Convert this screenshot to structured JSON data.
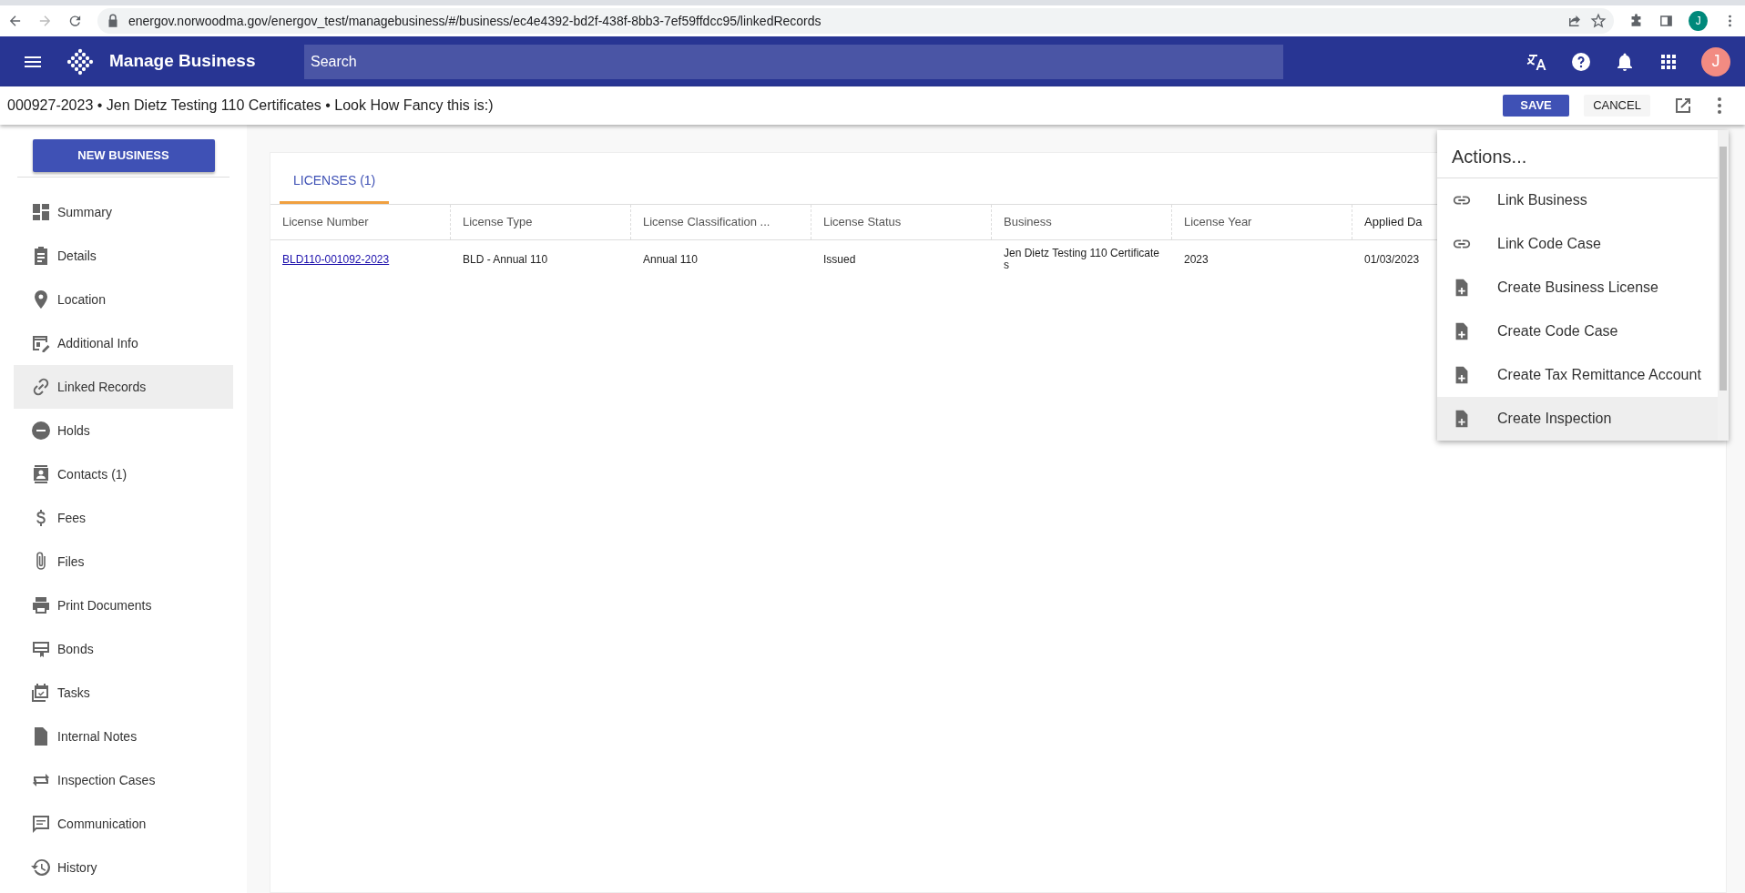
{
  "browser": {
    "url": "energov.norwoodma.gov/energov_test/managebusiness/#/business/ec4e4392-bd2f-438f-8bb3-7ef59ffdcc95/linkedRecords",
    "profile_initial": "J"
  },
  "app_bar": {
    "title": "Manage Business",
    "search": {
      "placeholder": "Search"
    },
    "user_initial": "J"
  },
  "record_bar": {
    "title": "000927-2023 • Jen Dietz Testing 110 Certificates • Look How Fancy this is:)",
    "buttons": [
      {
        "label": "SAVE",
        "kind": "primary"
      },
      {
        "label": "CANCEL",
        "kind": "plain"
      }
    ]
  },
  "sidebar": {
    "new_button": "NEW BUSINESS",
    "items": [
      {
        "label": "Summary",
        "selected": false
      },
      {
        "label": "Details",
        "selected": false
      },
      {
        "label": "Location",
        "selected": false
      },
      {
        "label": "Additional Info",
        "selected": false
      },
      {
        "label": "Linked Records",
        "selected": true
      },
      {
        "label": "Holds",
        "selected": false
      },
      {
        "label": "Contacts (1)",
        "selected": false
      },
      {
        "label": "Fees",
        "selected": false
      },
      {
        "label": "Files",
        "selected": false
      },
      {
        "label": "Print Documents",
        "selected": false
      },
      {
        "label": "Bonds",
        "selected": false
      },
      {
        "label": "Tasks",
        "selected": false
      },
      {
        "label": "Internal Notes",
        "selected": false
      },
      {
        "label": "Inspection Cases",
        "selected": false
      },
      {
        "label": "Communication",
        "selected": false
      },
      {
        "label": "History",
        "selected": false
      }
    ]
  },
  "tabs": [
    {
      "label": "LICENSES (1)",
      "selected": true
    }
  ],
  "table": {
    "columns": [
      "License Number",
      "License Type",
      "License Classification ...",
      "License Status",
      "Business",
      "License Year",
      "Applied Da"
    ],
    "rows": [
      [
        "BLD110-001092-2023",
        "BLD - Annual 110",
        "Annual 110",
        "Issued",
        "Jen Dietz Testing 110 Certificates",
        "2023",
        "01/03/2023"
      ]
    ]
  },
  "actions_menu": {
    "title": "Actions...",
    "items": [
      {
        "label": "Link Business",
        "kind": "link",
        "highlighted": false
      },
      {
        "label": "Link Code Case",
        "kind": "link",
        "highlighted": false
      },
      {
        "label": "Create Business License",
        "kind": "create",
        "highlighted": false
      },
      {
        "label": "Create Code Case",
        "kind": "create",
        "highlighted": false
      },
      {
        "label": "Create Tax Remittance Account",
        "kind": "create",
        "highlighted": false
      },
      {
        "label": "Create Inspection",
        "kind": "create",
        "highlighted": true
      }
    ]
  }
}
